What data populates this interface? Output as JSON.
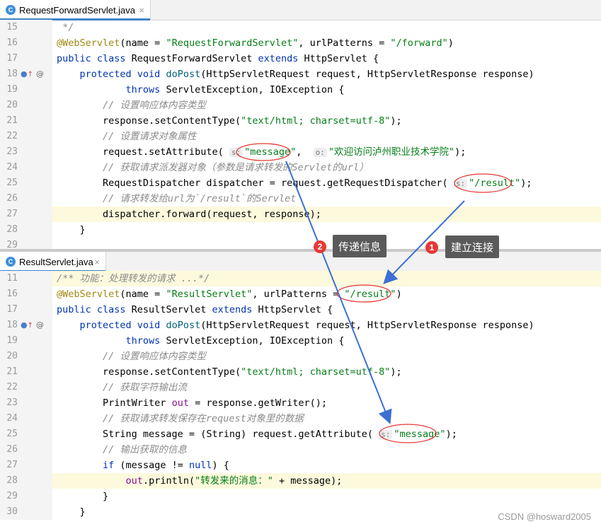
{
  "tabs": {
    "top": {
      "icon": "C",
      "label": "RequestForwardServlet.java",
      "close": "×"
    },
    "bottom": {
      "icon": "C",
      "label": "ResultServlet.java",
      "close": "×"
    }
  },
  "callouts": {
    "pass_info": {
      "number": "2",
      "label": "传递信息"
    },
    "establish": {
      "number": "1",
      "label": "建立连接"
    }
  },
  "watermark": "CSDN @hosward2005",
  "colors": {
    "highlight_line": "#fdf9dd",
    "ellipse": "#e53935",
    "arrow": "#3d6fd4",
    "keyword": "#0033b3",
    "string": "#067d17"
  }
}
